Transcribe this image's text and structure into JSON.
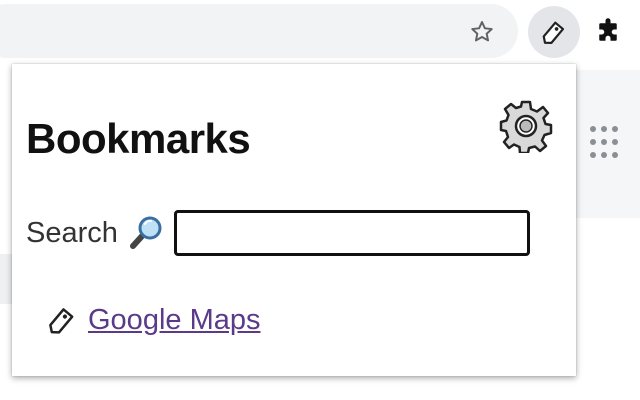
{
  "browser": {
    "toolbar_icons": [
      "star-icon",
      "tag-icon",
      "puzzle-icon"
    ]
  },
  "popup": {
    "title": "Bookmarks",
    "settings_icon": "gear-icon",
    "search": {
      "label": "Search",
      "icon": "magnifier-icon",
      "value": "",
      "placeholder": ""
    },
    "bookmarks": [
      {
        "label": "Google Maps",
        "icon": "tag-icon"
      }
    ]
  },
  "colors": {
    "link": "#5b3a8a",
    "omnibox_bg": "#f1f3f4",
    "text": "#111111"
  }
}
